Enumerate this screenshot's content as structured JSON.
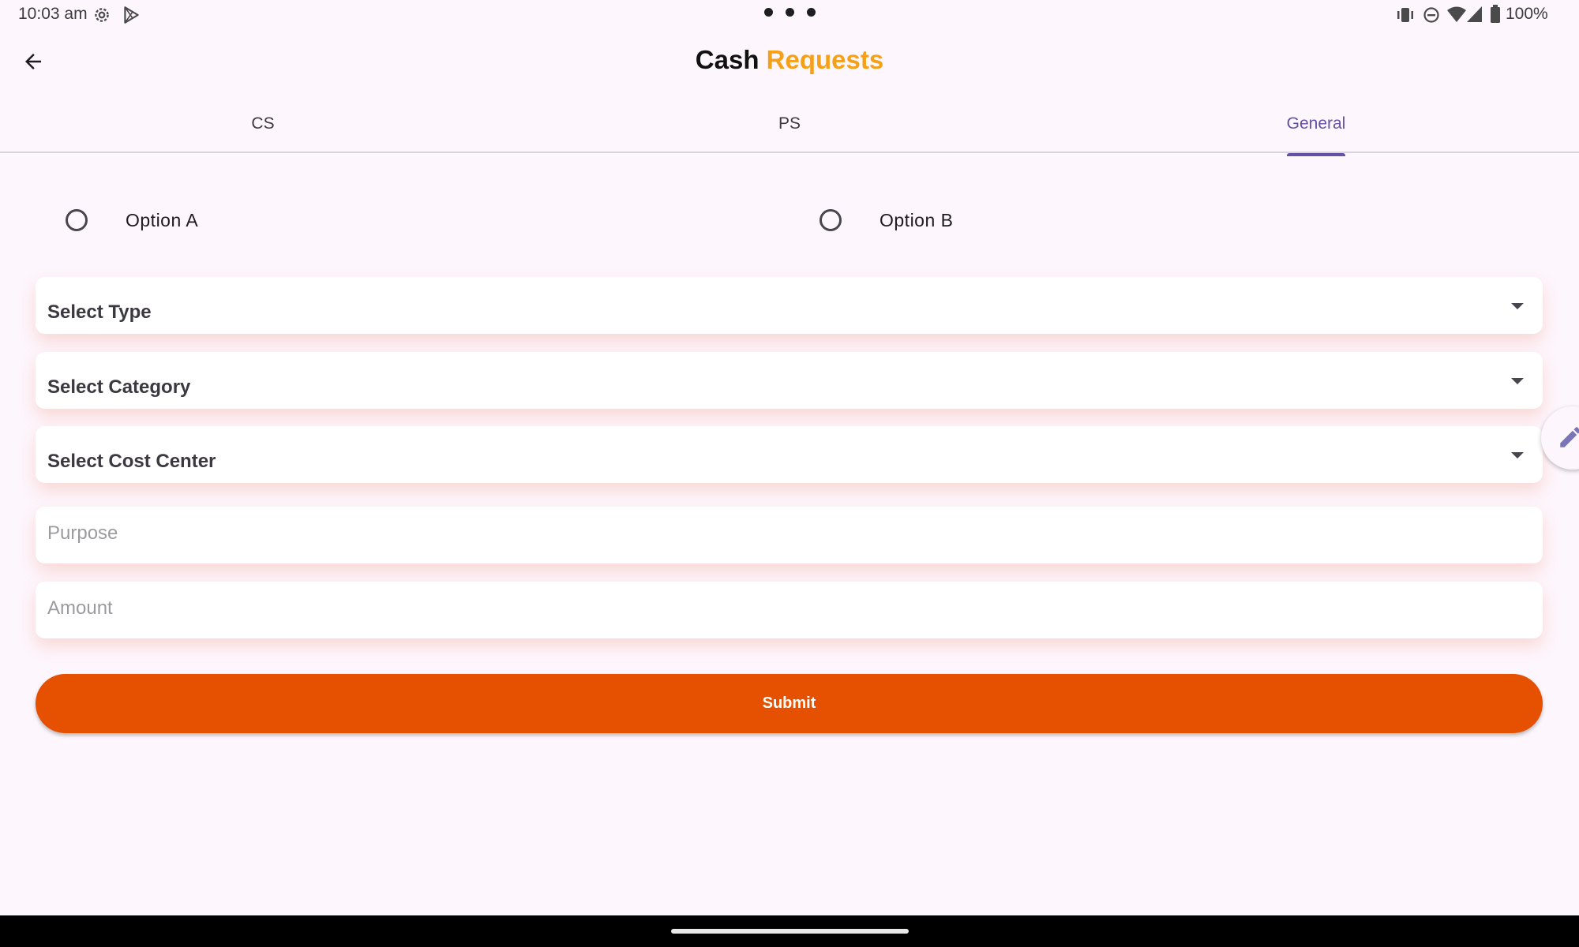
{
  "status_bar": {
    "time": "10:03 am",
    "battery": "100%",
    "left_icons": [
      "settings-gear-icon",
      "play-store-icon"
    ],
    "right_icons": [
      "vibrate-icon",
      "do-not-disturb-icon",
      "wifi-icon",
      "cell-signal-icon",
      "battery-icon"
    ]
  },
  "app_bar": {
    "title_part1": "Cash",
    "title_part2": "Requests",
    "back_icon": "arrow-back-icon"
  },
  "tabs": [
    {
      "label": "CS",
      "active": false
    },
    {
      "label": "PS",
      "active": false
    },
    {
      "label": "General",
      "active": true
    }
  ],
  "radio_options": [
    {
      "label": "Option A",
      "selected": false
    },
    {
      "label": "Option B",
      "selected": false
    }
  ],
  "dropdowns": {
    "type_label": "Select Type",
    "category_label": "Select Category",
    "cost_center_label": "Select Cost Center"
  },
  "inputs": {
    "purpose_placeholder": "Purpose",
    "amount_placeholder": "Amount"
  },
  "submit_label": "Submit",
  "fab_icon": "edit-pencil-icon",
  "colors": {
    "background": "#fdf6fc",
    "title_accent": "#f5a019",
    "tab_active": "#6750a4",
    "submit_button": "#e55100"
  }
}
